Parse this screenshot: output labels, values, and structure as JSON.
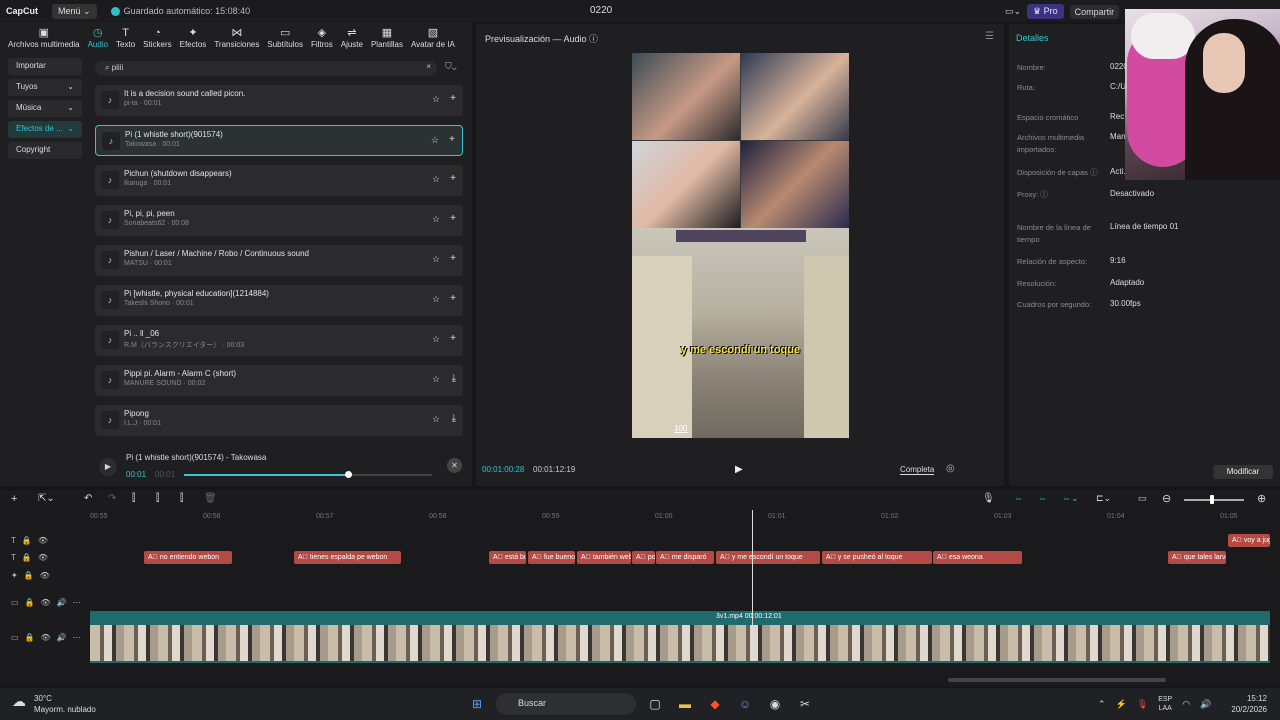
{
  "titlebar": {
    "logo": "CapCut",
    "menu": "Menú ⌄",
    "autosave": "Guardado automático: 15:08:40",
    "project": "0220",
    "pro": "♛ Pro",
    "share": "Compartir"
  },
  "toolbar": {
    "tools": [
      {
        "icon": "▣",
        "label": "Archivos multimedia",
        "active": false
      },
      {
        "icon": "◷",
        "label": "Audio",
        "active": true
      },
      {
        "icon": "T",
        "label": "Texto",
        "active": false
      },
      {
        "icon": "◔",
        "label": "Stickers",
        "active": false
      },
      {
        "icon": "✦",
        "label": "Efectos",
        "active": false
      },
      {
        "icon": "⋈",
        "label": "Transiciones",
        "active": false
      },
      {
        "icon": "▭",
        "label": "Subtítulos",
        "active": false
      },
      {
        "icon": "◈",
        "label": "Filtros",
        "active": false
      },
      {
        "icon": "⇌",
        "label": "Ajuste",
        "active": false
      },
      {
        "icon": "▦",
        "label": "Plantillas",
        "active": false
      },
      {
        "icon": "▧",
        "label": "Avatar de IA",
        "active": false
      }
    ]
  },
  "left_categories": [
    {
      "label": "Importar",
      "chev": ""
    },
    {
      "label": "Tuyos",
      "chev": "⌄"
    },
    {
      "label": "Música",
      "chev": "⌄"
    },
    {
      "label": "Efectos de ...",
      "chev": "⌄",
      "selected": true
    },
    {
      "label": "Copyright",
      "chev": ""
    }
  ],
  "search": {
    "value": "piiii",
    "clear": "×",
    "filter_icon": "⛉⌄"
  },
  "sounds": [
    {
      "title": "It is a decision sound called picon.",
      "meta": "pi-ta · 00:01",
      "action": "+"
    },
    {
      "title": "Pi (1 whistle short)(901574)",
      "meta": "Takowasa · 00:01",
      "action": "+",
      "selected": true
    },
    {
      "title": "Pichun (shutdown disappears)",
      "meta": "Ikaruga · 00:01",
      "action": "+"
    },
    {
      "title": "Pi, pi, pi, peen",
      "meta": "Sonabeats62 · 00:08",
      "action": "+"
    },
    {
      "title": "Pishun / Laser / Machine / Robo / Continuous sound",
      "meta": "MATSU · 00:01",
      "action": "+"
    },
    {
      "title": "Pi [whistle, physical education](1214884)",
      "meta": "Takeshi Shono · 00:01",
      "action": "+"
    },
    {
      "title": "Pi .. ll _06",
      "meta": "R.M（バランスクリエイター） · 00:03",
      "action": "+"
    },
    {
      "title": "Pippi pi. Alarm - Alarm C (short)",
      "meta": "MANURE SOUND · 00:02",
      "action": "⤓"
    },
    {
      "title": "Pipong",
      "meta": "I.L.J · 00:01",
      "action": "⤓"
    }
  ],
  "player": {
    "title": "Pi (1 whistle short)(901574) - Takowasa",
    "current": "00:01",
    "total": "00:01",
    "progress": 0.66
  },
  "preview": {
    "title": "Previsualización — Audio ⓘ",
    "caption": "y me escondí un toque",
    "hp": "100",
    "current": "00:01:00:28",
    "total": "00:01:12:19",
    "play": "▶",
    "mode": "Completa"
  },
  "details": {
    "header": "Detalles",
    "rows": [
      {
        "label": "Nombre:",
        "value": "0220"
      },
      {
        "label": "Ruta:",
        "value": "C:/U... Data..."
      },
      {
        "label": "Espacio cromático",
        "value": "Rec..."
      },
      {
        "label": "Archivos multimedia importados:",
        "value": "Man..."
      },
      {
        "label": "Disposición de capas ⓘ",
        "value": "Acti..."
      },
      {
        "label": "Proxy: ⓘ",
        "value": "Desactivado"
      },
      {
        "label": "Nombre de la línea de tiempo",
        "value": "Línea de tiempo 01"
      },
      {
        "label": "Relación de aspecto:",
        "value": "9:16"
      },
      {
        "label": "Resolución:",
        "value": "Adaptado"
      },
      {
        "label": "Cuadros por segundo:",
        "value": "30.00fps"
      }
    ],
    "modify": "Modificar"
  },
  "timeline": {
    "ruler": [
      "00:55",
      "00:56",
      "00:57",
      "00:58",
      "00:59",
      "01:00",
      "01:01",
      "01:02",
      "01:03",
      "01:04",
      "01:05"
    ],
    "subtitles": [
      {
        "text": "A⃞ no entiendo webon"
      },
      {
        "text": "A⃞ tienes espalda pe webon"
      },
      {
        "text": "A⃞ está bu"
      },
      {
        "text": "A⃞ fue bueno"
      },
      {
        "text": "A⃞ también web"
      },
      {
        "text": "A⃞ po"
      },
      {
        "text": "A⃞ me disparó"
      },
      {
        "text": "A⃞ y me escondí un toque"
      },
      {
        "text": "A⃞ y se pusheó al toque"
      },
      {
        "text": "A⃞ esa weona"
      },
      {
        "text": "A⃞ que tales larva"
      },
      {
        "text": "A⃞ voy a juga"
      }
    ],
    "video_label": "3v1.mp4   00:00:12:01"
  },
  "taskbar": {
    "weather_temp": "30°C",
    "weather_desc": "Mayorm. nublado",
    "search": "Buscar",
    "lang1": "ESP",
    "lang2": "LAA",
    "time": "15:12",
    "date": "20/2/2026"
  }
}
